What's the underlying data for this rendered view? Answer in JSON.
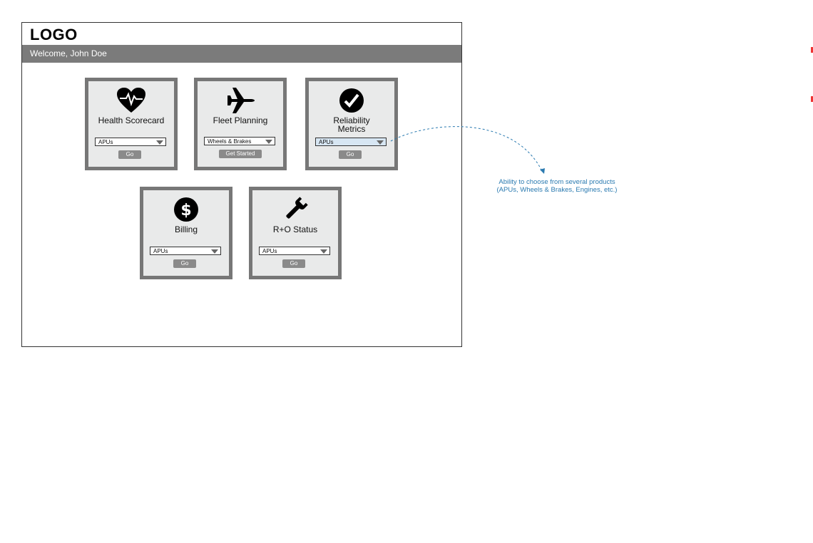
{
  "header": {
    "logo": "LOGO",
    "welcome": "Welcome, John Doe"
  },
  "tiles": [
    {
      "title": "Health Scorecard",
      "icon": "heart-pulse-icon",
      "select": "APUs",
      "button": "Go"
    },
    {
      "title": "Fleet Planning",
      "icon": "airplane-icon",
      "select": "Wheels & Brakes",
      "button": "Get Started"
    },
    {
      "title_line1": "Reliability",
      "title_line2": "Metrics",
      "icon": "checkmark-icon",
      "select": "APUs",
      "button": "Go"
    },
    {
      "title": "Billing",
      "icon": "dollar-icon",
      "select": "APUs",
      "button": "Go"
    },
    {
      "title": "R+O Status",
      "icon": "wrench-icon",
      "select": "APUs",
      "button": "Go"
    }
  ],
  "annotation": {
    "line1": "Ability to choose from several products",
    "line2": "(APUs, Wheels & Brakes, Engines, etc.)",
    "color": "#2a7ab0"
  }
}
